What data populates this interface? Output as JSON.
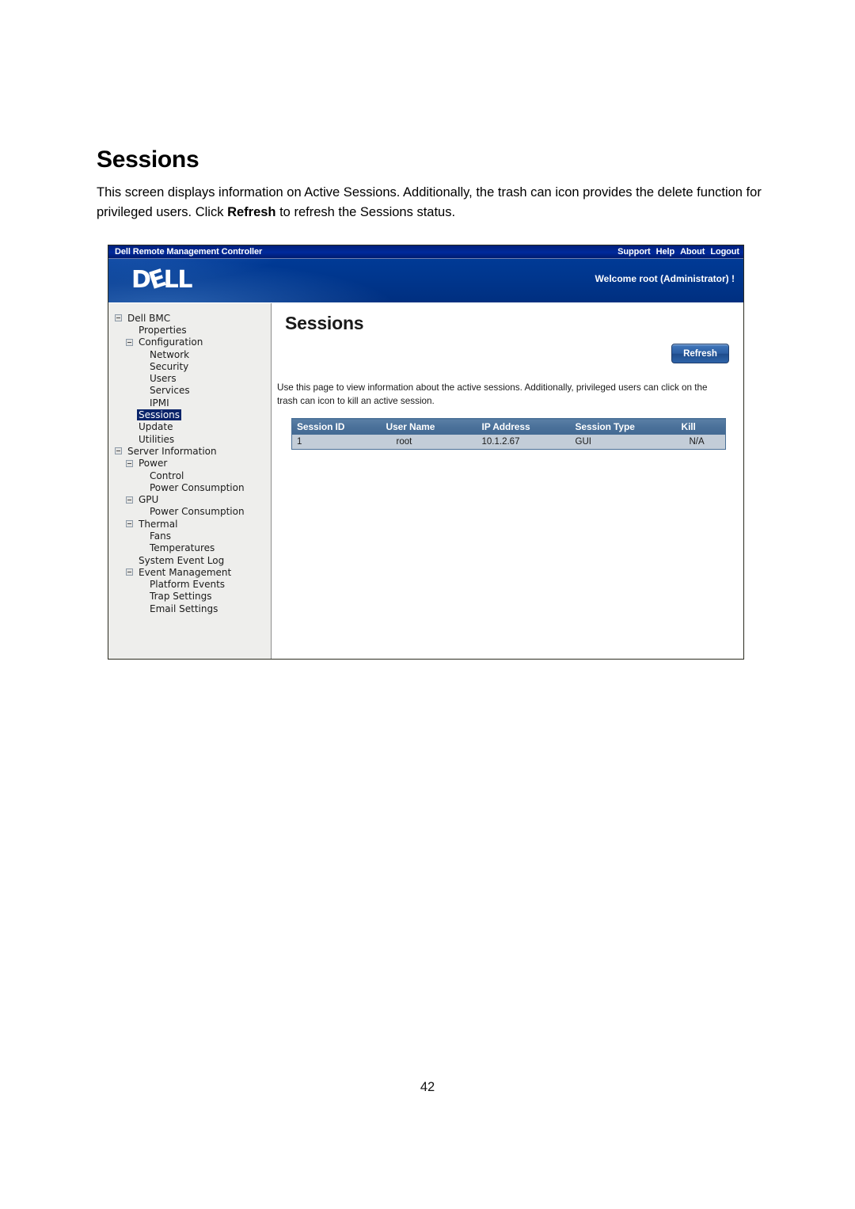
{
  "document": {
    "heading": "Sessions",
    "paragraph_part1": "This screen displays information on Active Sessions. Additionally, the trash can icon provides the delete function for privileged users. Click ",
    "paragraph_bold": "Refresh",
    "paragraph_part2": " to refresh the Sessions status.",
    "page_number": "42"
  },
  "app": {
    "titlebar": {
      "product_name": "Dell Remote Management Controller",
      "links": [
        {
          "label": "Support"
        },
        {
          "label": "Help"
        },
        {
          "label": "About"
        },
        {
          "label": "Logout"
        }
      ]
    },
    "banner": {
      "logo_d": "D",
      "logo_e": "E",
      "logo_ll": "LL",
      "welcome": "Welcome root (Administrator) !"
    },
    "sidebar": {
      "items": [
        {
          "label": "Dell BMC",
          "level": 0,
          "toggle": true,
          "selected": false
        },
        {
          "label": "Properties",
          "level": 1,
          "toggle": false,
          "selected": false
        },
        {
          "label": "Configuration",
          "level": 1,
          "toggle": true,
          "selected": false
        },
        {
          "label": "Network",
          "level": 2,
          "toggle": false,
          "selected": false
        },
        {
          "label": "Security",
          "level": 2,
          "toggle": false,
          "selected": false
        },
        {
          "label": "Users",
          "level": 2,
          "toggle": false,
          "selected": false
        },
        {
          "label": "Services",
          "level": 2,
          "toggle": false,
          "selected": false
        },
        {
          "label": "IPMI",
          "level": 2,
          "toggle": false,
          "selected": false
        },
        {
          "label": "Sessions",
          "level": 1,
          "toggle": false,
          "selected": true
        },
        {
          "label": "Update",
          "level": 1,
          "toggle": false,
          "selected": false
        },
        {
          "label": "Utilities",
          "level": 1,
          "toggle": false,
          "selected": false
        },
        {
          "label": "Server Information",
          "level": 0,
          "toggle": true,
          "selected": false
        },
        {
          "label": "Power",
          "level": 1,
          "toggle": true,
          "selected": false
        },
        {
          "label": "Control",
          "level": 2,
          "toggle": false,
          "selected": false
        },
        {
          "label": "Power Consumption",
          "level": 2,
          "toggle": false,
          "selected": false
        },
        {
          "label": "GPU",
          "level": 1,
          "toggle": true,
          "selected": false
        },
        {
          "label": "Power Consumption",
          "level": 2,
          "toggle": false,
          "selected": false
        },
        {
          "label": "Thermal",
          "level": 1,
          "toggle": true,
          "selected": false
        },
        {
          "label": "Fans",
          "level": 2,
          "toggle": false,
          "selected": false
        },
        {
          "label": "Temperatures",
          "level": 2,
          "toggle": false,
          "selected": false
        },
        {
          "label": "System Event Log",
          "level": 1,
          "toggle": false,
          "selected": false
        },
        {
          "label": "Event Management",
          "level": 1,
          "toggle": true,
          "selected": false
        },
        {
          "label": "Platform Events",
          "level": 2,
          "toggle": false,
          "selected": false
        },
        {
          "label": "Trap Settings",
          "level": 2,
          "toggle": false,
          "selected": false
        },
        {
          "label": "Email Settings",
          "level": 2,
          "toggle": false,
          "selected": false
        }
      ]
    },
    "content": {
      "title": "Sessions",
      "refresh_label": "Refresh",
      "description": "Use this page to view information about the active sessions. Additionally, privileged users can click on the trash can icon to kill an active session.",
      "table": {
        "columns": [
          "Session ID",
          "User Name",
          "IP Address",
          "Session Type",
          "Kill"
        ],
        "rows": [
          [
            "1",
            "root",
            "10.1.2.67",
            "GUI",
            "N/A"
          ]
        ]
      }
    }
  },
  "colors": {
    "titlebar_blue": "#00248c",
    "banner_blue": "#003a96",
    "selection_navy": "#0a246a",
    "table_header_blue": "#4a7099",
    "table_row_blue": "#c3cdd8",
    "button_blue": "#2c5ea3"
  }
}
